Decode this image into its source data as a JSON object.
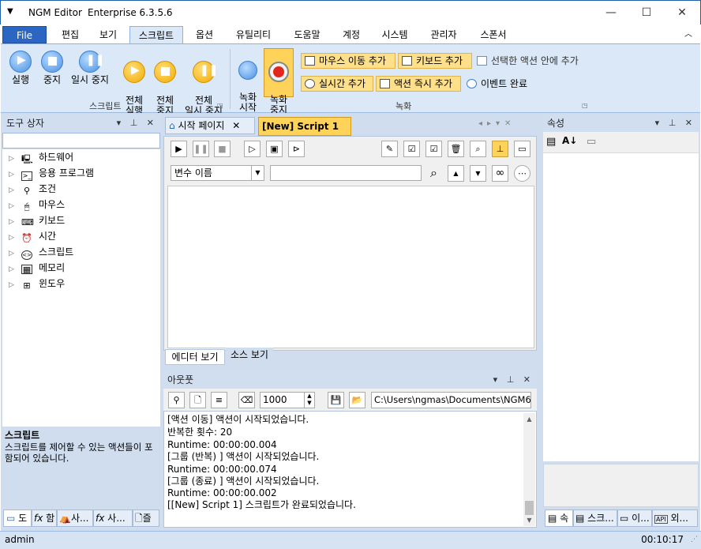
{
  "window": {
    "app_name": "NGM Editor",
    "edition": "Enterprise 6.3.5.6"
  },
  "menu": {
    "file": "File",
    "tabs": [
      "편집",
      "보기",
      "스크립트",
      "옵션",
      "유틸리티",
      "도움말",
      "계정",
      "시스템",
      "관리자",
      "스폰서"
    ],
    "active": "스크립트"
  },
  "ribbon": {
    "script_group": {
      "label": "스크립트",
      "play": "실행",
      "stop": "중지",
      "pause": "일시 중지",
      "play_all": "전체\n실행",
      "stop_all": "전체\n중지",
      "pause_all": "전체\n일시 중지"
    },
    "record_group": {
      "label": "녹화",
      "start": "녹화\n시작",
      "stop": "녹화\n중지",
      "add_mouse_move": "마우스 이동 추가",
      "add_keyboard": "키보드 추가",
      "add_inside_selected": "선택한 액션 안에 추가",
      "add_realtime": "실시간 추가",
      "add_action_now": "액션 즉시 추가",
      "event_done": "이벤트 완료"
    }
  },
  "toolbox": {
    "title": "도구 상자",
    "items": [
      "하드웨어",
      "응용 프로그램",
      "조건",
      "마우스",
      "키보드",
      "시간",
      "스크립트",
      "메모리",
      "윈도우"
    ],
    "desc_title": "스크립트",
    "desc_text": "스크립트를 제어할 수 있는 액션들이 포함되어 있습니다.",
    "bottom_tabs": [
      "도",
      "함",
      "사...",
      "사...",
      "즐"
    ]
  },
  "editor": {
    "tabs": [
      "시작 페이지",
      "[New] Script 1"
    ],
    "var_select": "변수 이름",
    "var_value": "",
    "view_tabs": [
      "에디터 보기",
      "소스 보기"
    ]
  },
  "output": {
    "title": "아웃풋",
    "repeat": "1000",
    "path": "C:\\Users\\ngmas\\Documents\\NGM6\\",
    "lines": [
      "[액션 이동] 액션이 시작되었습니다.",
      "반복한 횟수: 20",
      "Runtime: 00:00:00.004",
      "[그룹 (반복) ] 액션이 시작되었습니다.",
      "Runtime: 00:00:00.074",
      "[그룹 (종료) ] 액션이 시작되었습니다.",
      "Runtime: 00:00:00.002",
      "[[New] Script 1] 스크립트가 완료되었습니다."
    ]
  },
  "properties": {
    "title": "속성",
    "bottom_tabs": [
      "속",
      "스크...",
      "이...",
      "외..."
    ]
  },
  "status": {
    "user": "admin",
    "time": "00:10:17"
  },
  "colors": {
    "accent": "#2b67c2",
    "panel": "#d0def0",
    "ribbon": "#dbe8f7",
    "highlight": "#ffd35a"
  }
}
